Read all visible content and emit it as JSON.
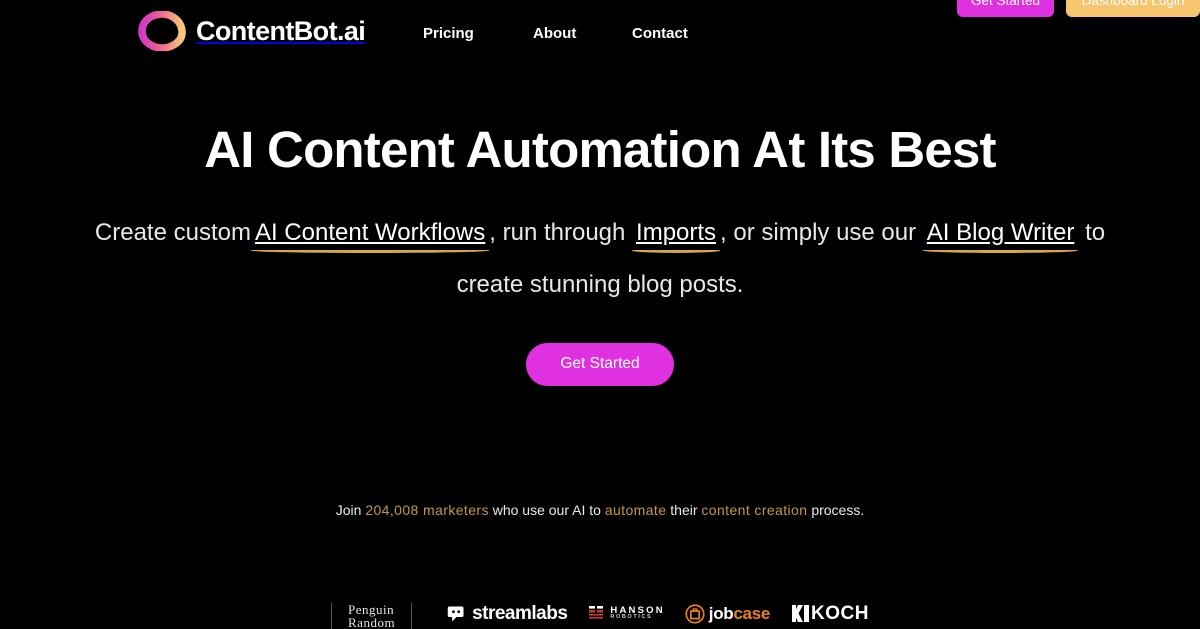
{
  "brand": {
    "name": "ContentBot.ai",
    "logo_icon": "ring-gradient-logo-icon",
    "gradient_start": "#E0349E",
    "gradient_mid": "#EE7BA0",
    "gradient_end": "#F7C27A"
  },
  "nav": {
    "links": [
      {
        "label": "Pricing"
      },
      {
        "label": "About"
      },
      {
        "label": "Contact"
      }
    ]
  },
  "header_actions": {
    "get_started": {
      "label": "Get Started",
      "color": "#E031E0"
    },
    "dashboard_login": {
      "label": "Dashboard Login",
      "color": "#F6C570"
    }
  },
  "hero": {
    "headline": "AI Content Automation At Its Best",
    "sub_part_1": "Create custom",
    "sub_link_1": "AI Content Workflows",
    "sub_part_2": ", run through",
    "sub_link_2": "Imports",
    "sub_part_3": ", or simply use our",
    "sub_link_3": "AI Blog Writer",
    "sub_part_4": "to create stunning blog posts.",
    "underline_color": "#D4A843",
    "cta_label": "Get Started",
    "cta_color": "#E031E0"
  },
  "social_proof": {
    "prefix": "Join ",
    "count": "204,008 marketers",
    "middle": " who use our AI to ",
    "highlight_2": "automate",
    "middle_2": " their ",
    "highlight_3": "content creation",
    "suffix": " process.",
    "accent_color": "#C39A43"
  },
  "partners": {
    "items": [
      {
        "name": "Penguin Random House",
        "line1": "Penguin",
        "line2": "Random"
      },
      {
        "name": "streamlabs",
        "label": "streamlabs"
      },
      {
        "name": "Hanson Robotics",
        "line1": "HANSON",
        "line2": "ROBOTICS"
      },
      {
        "name": "jobcase",
        "label_a": "job",
        "label_b": "case"
      },
      {
        "name": "KOCH",
        "label": "KOCH"
      }
    ]
  }
}
